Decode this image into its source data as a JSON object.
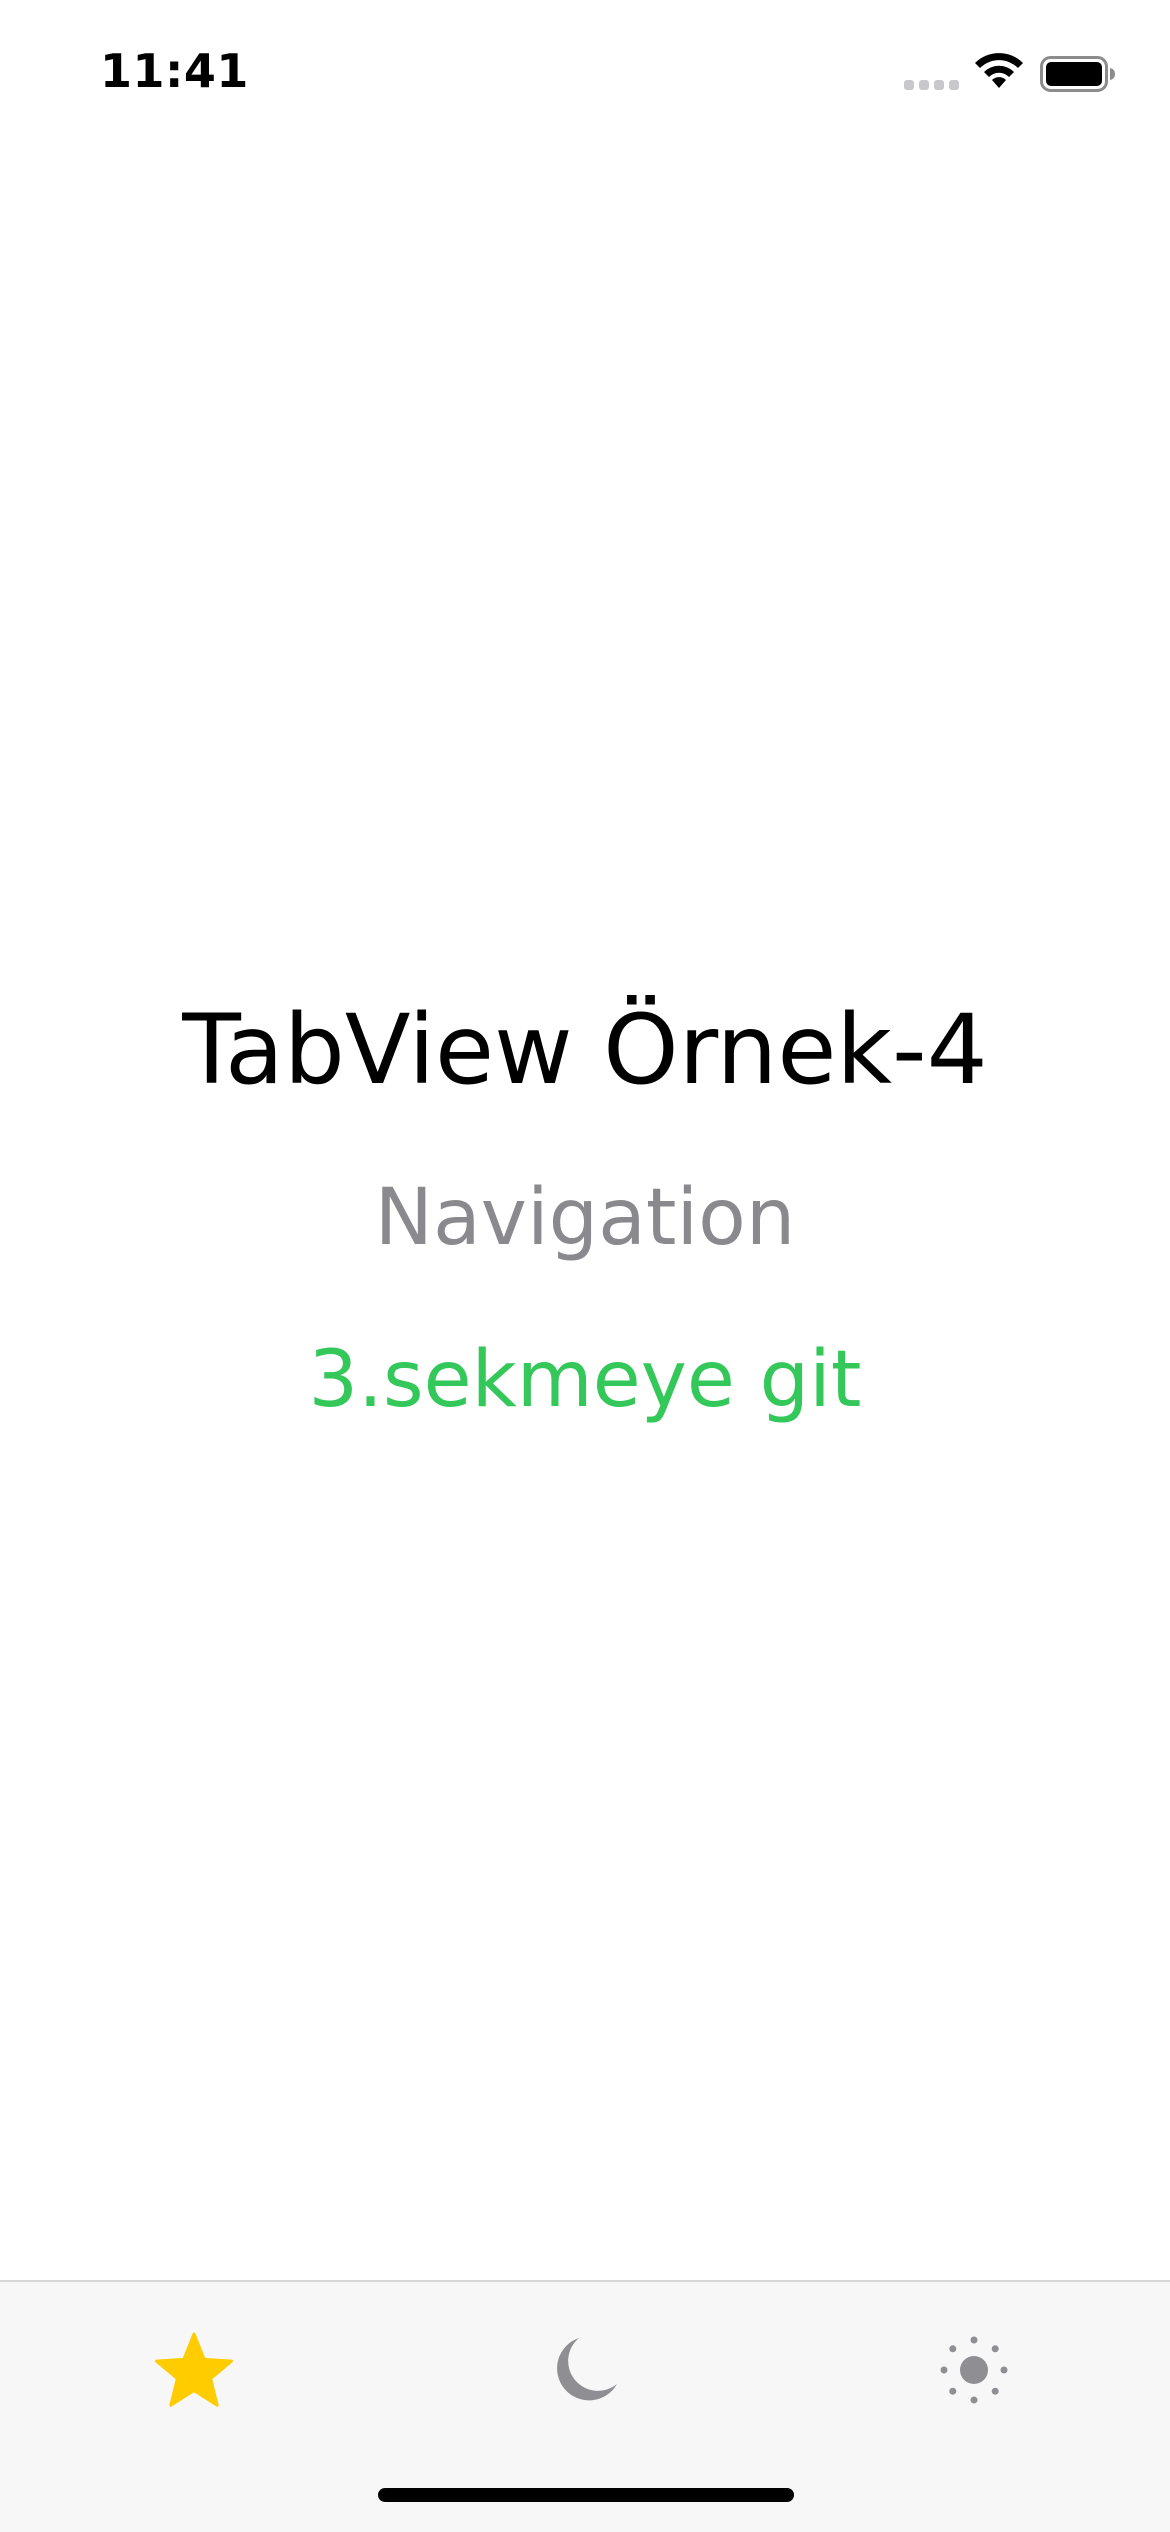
{
  "status_bar": {
    "time": "11:41",
    "icons": [
      "cellular-signal-icon",
      "wifi-icon",
      "battery-icon"
    ]
  },
  "main": {
    "title": "TabView Örnek-4",
    "subtitle": "Navigation",
    "link_label": "3.sekmeye git"
  },
  "tab_bar": {
    "items": [
      {
        "icon": "star-icon",
        "selected": true,
        "color": "#ffcc00"
      },
      {
        "icon": "moon-icon",
        "selected": false,
        "color": "#8e8e93"
      },
      {
        "icon": "sun-icon",
        "selected": false,
        "color": "#8e8e93"
      }
    ]
  },
  "colors": {
    "accent_green": "#34c759",
    "secondary_gray": "#8a8a8e",
    "tab_selected": "#ffcc00",
    "tab_unselected": "#8e8e93",
    "tab_bar_background": "#f7f7f7"
  }
}
